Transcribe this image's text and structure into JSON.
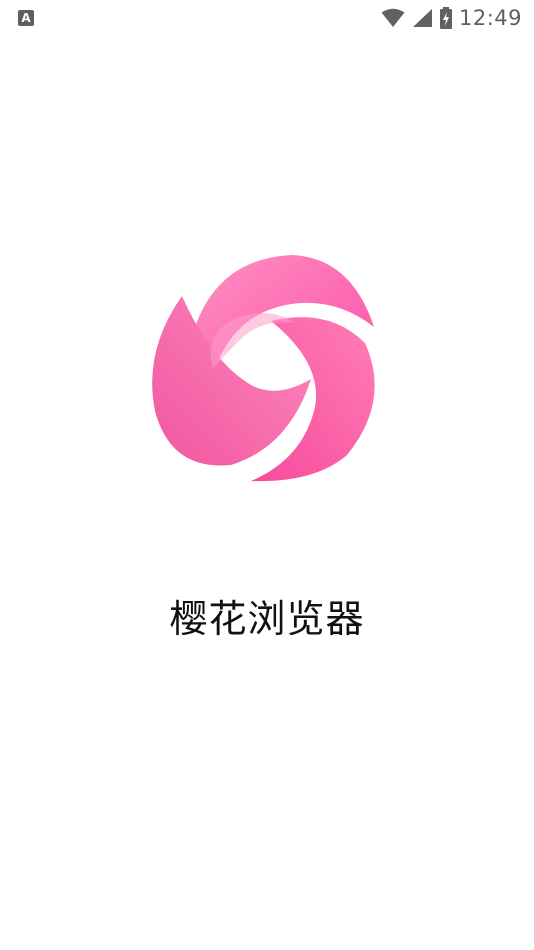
{
  "status_bar": {
    "left_icon": "A",
    "left_icon_name": "keyboard-a-icon",
    "time": "12:49",
    "icons": [
      "wifi-icon",
      "cellular-signal-icon",
      "battery-charging-icon"
    ]
  },
  "splash": {
    "app_name": "樱花浏览器",
    "logo": "sakura-browser-logo-icon"
  },
  "colors": {
    "background": "#ffffff",
    "logo_pink": "#fb5aa8",
    "logo_light": "#ff8fc2",
    "logo_dark": "#f04d93",
    "text": "#111111",
    "status_icon": "#5f5f5f"
  }
}
